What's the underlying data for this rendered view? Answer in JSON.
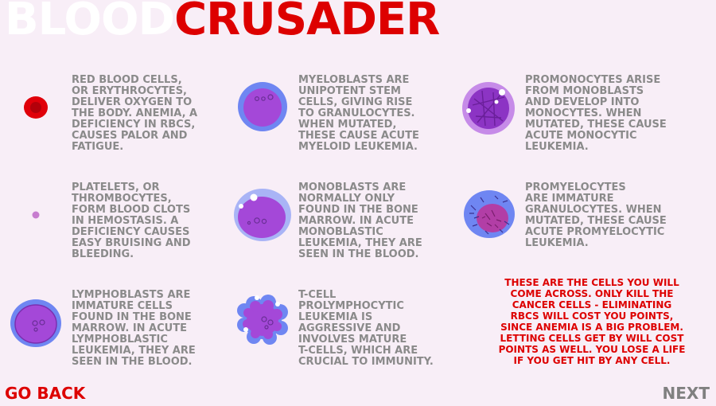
{
  "title": {
    "part1": "BLOOD",
    "part2": "CRUSADER"
  },
  "cells": [
    {
      "icon": "red-blood-cell-icon",
      "text": "RED BLOOD CELLS,\nOR ERYTHROCYTES,\nDELIVER OXYGEN TO\nTHE BODY.  ANEMIA, A\nDEFICIENCY IN RBCS,\nCAUSES PALOR AND\nFATIGUE."
    },
    {
      "icon": "myeloblast-icon",
      "text": "MYELOBLASTS ARE\nUNIPOTENT STEM\nCELLS, GIVING RISE\nTO GRANULOCYTES.\nWHEN MUTATED,\nTHESE CAUSE ACUTE\nMYELOID LEUKEMIA."
    },
    {
      "icon": "promonocyte-icon",
      "text": "PROMONOCYTES ARISE\nFROM MONOBLASTS\nAND DEVELOP INTO\nMONOCYTES.  WHEN\nMUTATED, THESE CAUSE\nACUTE MONOCYTIC\nLEUKEMIA."
    },
    {
      "icon": "platelet-icon",
      "text": "PLATELETS, OR\nTHROMBOCYTES,\nFORM BLOOD CLOTS\nIN HEMOSTASIS.  A\nDEFICIENCY CAUSES\nEASY BRUISING AND\nBLEEDING."
    },
    {
      "icon": "monoblast-icon",
      "text": "MONOBLASTS ARE\nNORMALLY ONLY\nFOUND IN THE BONE\nMARROW.  IN ACUTE\nMONOBLASTIC\nLEUKEMIA, THEY ARE\nSEEN IN THE BLOOD."
    },
    {
      "icon": "promyelocyte-icon",
      "text": "PROMYELOCYTES\nARE IMMATURE\nGRANULOCYTES.  WHEN\nMUTATED, THESE CAUSE\nACUTE PROMYELOCYTIC\nLEUKEMIA."
    },
    {
      "icon": "lymphoblast-icon",
      "text": "LYMPHOBLASTS ARE\nIMMATURE CELLS\nFOUND IN THE BONE\nMARROW.  IN ACUTE\nLYMPHOBLASTIC\nLEUKEMIA, THEY ARE\nSEEN IN THE BLOOD."
    },
    {
      "icon": "t-cell-icon",
      "text": "T-CELL\nPROLYMPHOCYTIC\nLEUKEMIA IS\nAGGRESSIVE AND\nINVOLVES MATURE\nT-CELLS, WHICH ARE\nCRUCIAL TO IMMUNITY."
    }
  ],
  "note": "THESE ARE THE CELLS YOU WILL\nCOME ACROSS.  ONLY KILL THE\nCANCER CELLS - ELIMINATING\nRBCS WILL COST YOU POINTS,\nSINCE ANEMIA IS A BIG PROBLEM.\nLETTING CELLS GET BY WILL COST\nPOINTS AS WELL.  YOU LOSE A LIFE\nIF YOU GET HIT BY ANY CELL.",
  "nav": {
    "back_label": "GO BACK",
    "next_label": "NEXT"
  },
  "colors": {
    "accent_red": "#dd0000",
    "text_gray": "#8a8a8a",
    "background": "#f8eef7",
    "cell_purple": "#a448d8",
    "cell_blue": "#6f86f2"
  }
}
